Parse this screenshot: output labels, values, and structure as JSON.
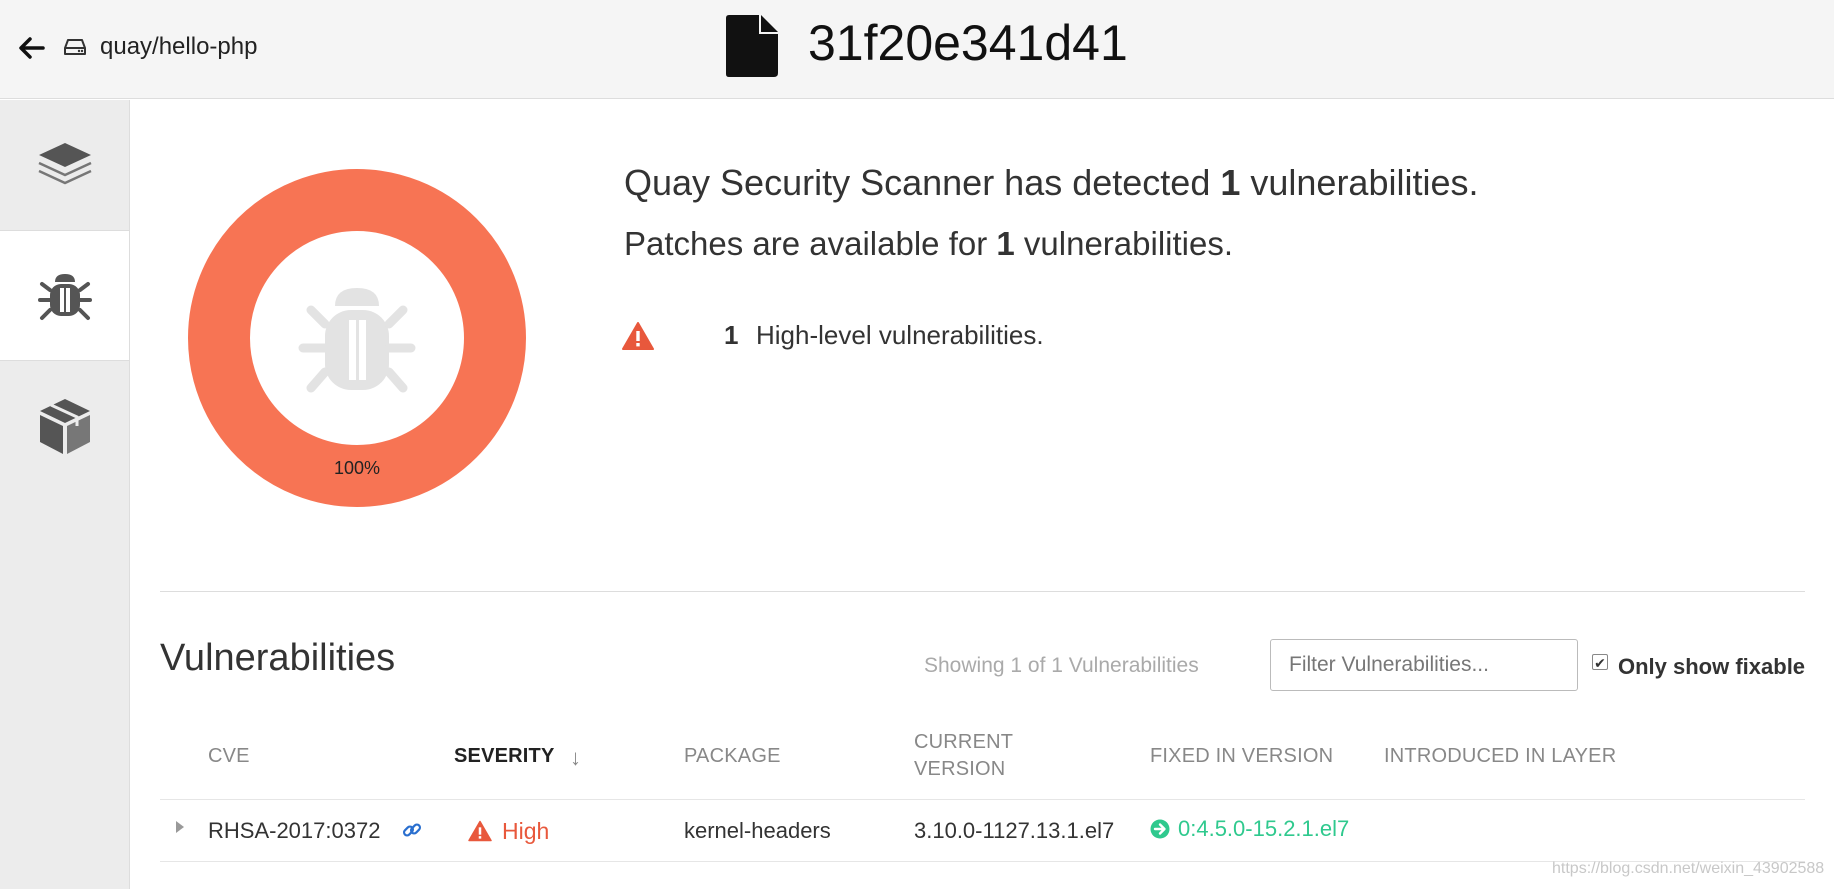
{
  "header": {
    "repo_name": "quay/hello-php",
    "layer_id": "31f20e341d41"
  },
  "sidebar": {
    "tabs": [
      {
        "icon": "layers-icon",
        "active": false
      },
      {
        "icon": "bug-icon",
        "active": true
      },
      {
        "icon": "package-icon",
        "active": false
      }
    ]
  },
  "summary": {
    "donut_percent_label": "100%",
    "donut_fraction": 1.0,
    "donut_color": "#f77454",
    "line1_prefix": "Quay Security Scanner has detected ",
    "line1_count": "1",
    "line1_suffix": " vulnerabilities.",
    "line2_prefix": "Patches are available for ",
    "line2_count": "1",
    "line2_suffix": " vulnerabilities.",
    "severity_count": "1",
    "severity_text": "High-level vulnerabilities."
  },
  "vulnerabilities": {
    "title": "Vulnerabilities",
    "showing_text": "Showing 1 of 1 Vulnerabilities",
    "filter_placeholder": "Filter Vulnerabilities...",
    "only_fixable_label": "Only show fixable",
    "only_fixable_checked": true,
    "columns": {
      "cve": "CVE",
      "severity": "SEVERITY",
      "package": "PACKAGE",
      "current_version_line1": "CURRENT",
      "current_version_line2": "VERSION",
      "fixed_in_version": "FIXED IN VERSION",
      "introduced_in_layer": "INTRODUCED IN LAYER"
    },
    "rows": [
      {
        "cve": "RHSA-2017:0372",
        "severity": "High",
        "package": "kernel-headers",
        "current_version": "3.10.0-1127.13.1.el7",
        "fixed_in_version": "0:4.5.0-15.2.1.el7",
        "introduced_in_layer": ""
      }
    ]
  },
  "colors": {
    "high": "#e8583c",
    "fixed": "#2fc98e",
    "link": "#2a6fcf"
  },
  "watermark": "https://blog.csdn.net/weixin_43902588"
}
